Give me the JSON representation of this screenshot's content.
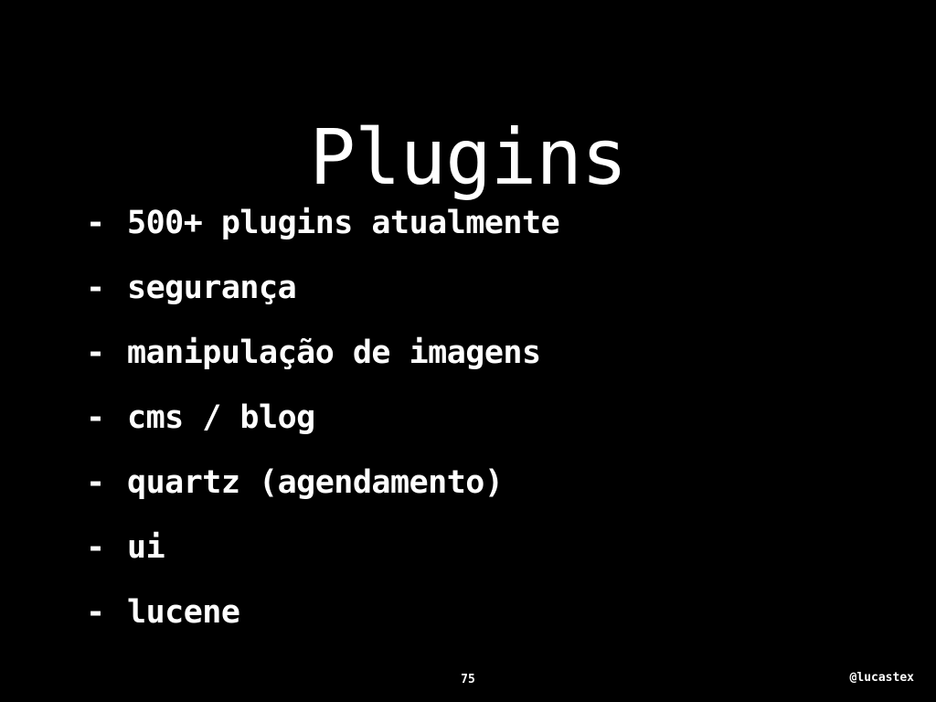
{
  "slide": {
    "title": "Plugins",
    "bullet_marker": "-",
    "bullets": [
      "500+ plugins atualmente",
      "segurança",
      "manipulação de imagens",
      "cms / blog",
      "quartz (agendamento)",
      "ui",
      "lucene"
    ],
    "page_number": "75",
    "author_handle": "@lucastex"
  },
  "colors": {
    "background": "#000000",
    "text": "#ffffff"
  }
}
